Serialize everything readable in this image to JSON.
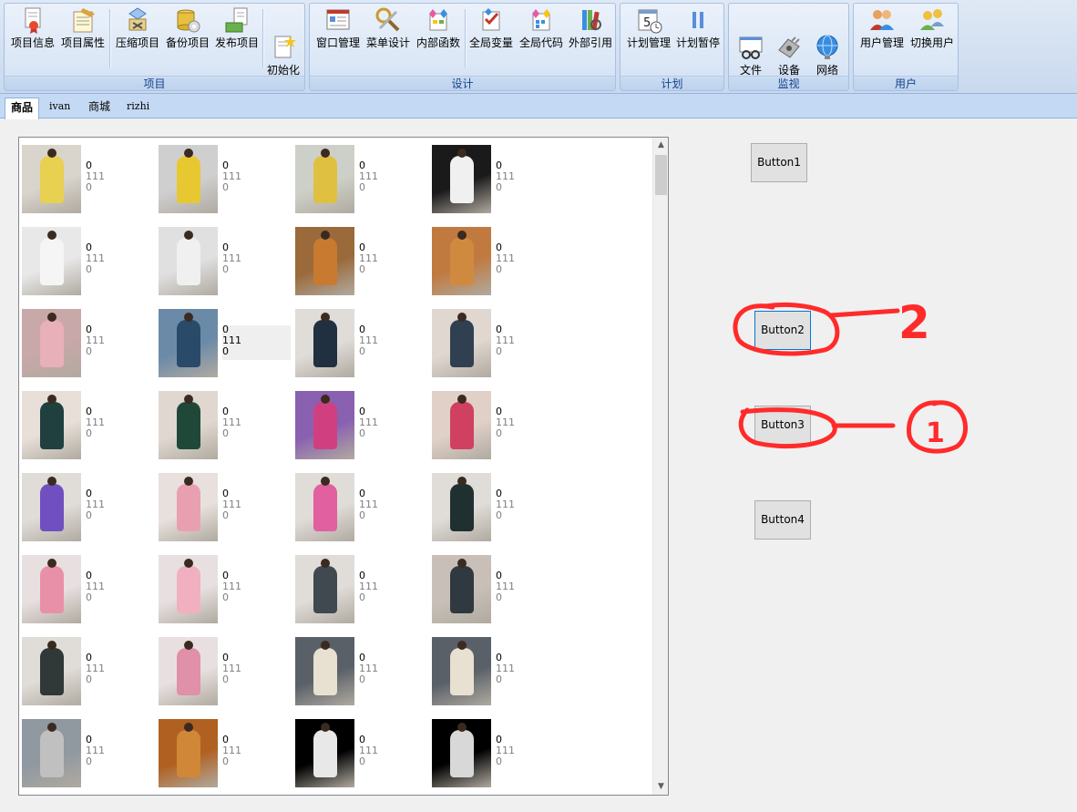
{
  "ribbon": {
    "groups": [
      {
        "caption": "项目",
        "buttons": [
          "项目信息",
          "项目属性",
          "压缩项目",
          "备份项目",
          "发布项目",
          "初始化\n项目"
        ]
      },
      {
        "caption": "设计",
        "buttons": [
          "窗口管理",
          "菜单设计",
          "内部函数",
          "全局变量",
          "全局代码",
          "外部引用"
        ]
      },
      {
        "caption": "计划",
        "buttons": [
          "计划管理",
          "计划暂停"
        ]
      },
      {
        "caption": "监视",
        "buttons": [
          "文件\n监视器",
          "设备\n监视器",
          "网络\n监视器"
        ]
      },
      {
        "caption": "用户",
        "buttons": [
          "用户管理",
          "切换用户"
        ]
      }
    ],
    "calendar_number": "5"
  },
  "tabs": [
    {
      "label": "商品",
      "active": true
    },
    {
      "label": "ivan",
      "active": false
    },
    {
      "label": "商城",
      "active": false
    },
    {
      "label": "rizhi",
      "active": false
    }
  ],
  "grid": {
    "line1": "0",
    "line2": "111",
    "line3": "0",
    "selected_index": 9,
    "rows": 8,
    "cols": 4
  },
  "buttons": {
    "button1": "Button1",
    "button2": "Button2",
    "button3": "Button3",
    "button4": "Button4"
  },
  "annotations": {
    "label_2": "2",
    "label_1": "1"
  },
  "colors": {
    "annotation": "#ff2b2b",
    "focus": "#0078d7",
    "ribbon_caption": "#15428b"
  }
}
